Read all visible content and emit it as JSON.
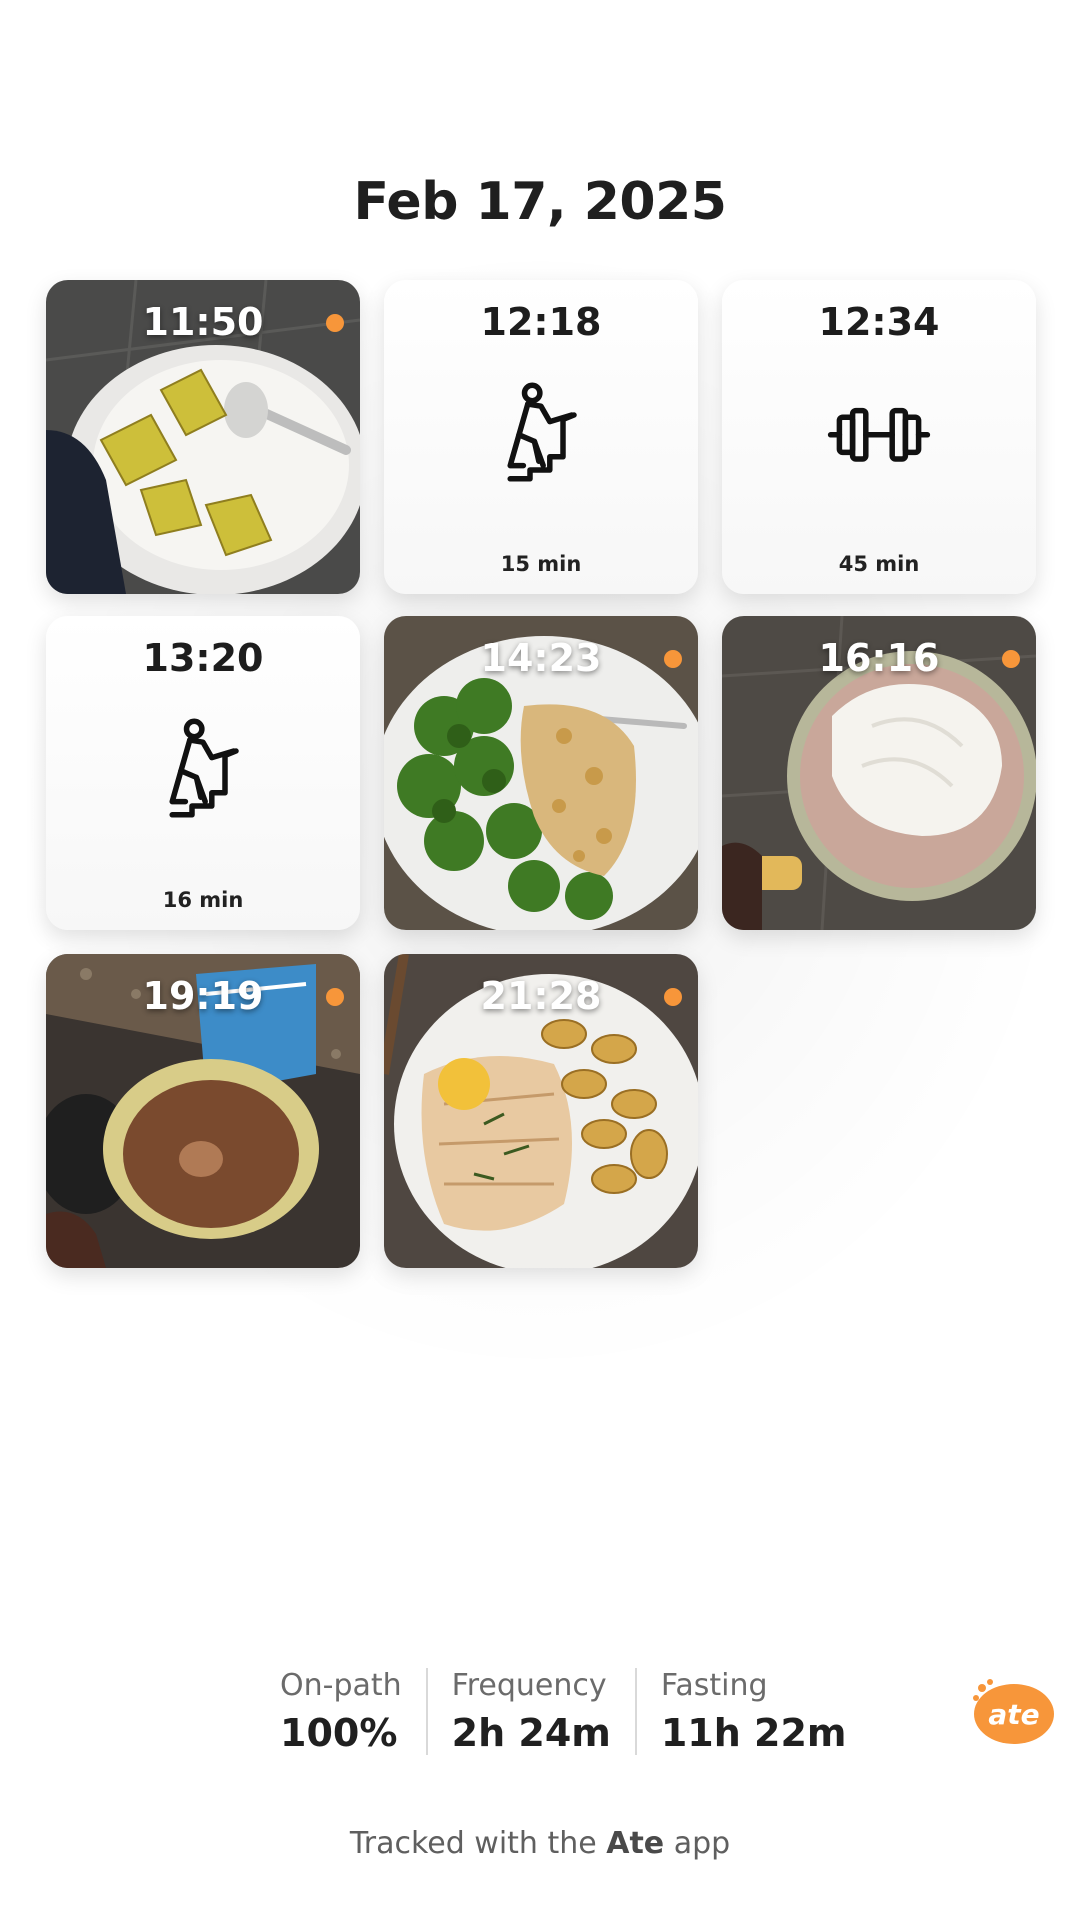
{
  "header": {
    "date": "Feb 17, 2025"
  },
  "accent_color": "#f7963a",
  "tiles": [
    {
      "kind": "photo",
      "time": "11:50",
      "subject": "kiwi-yogurt-bowl",
      "has_dot": true
    },
    {
      "kind": "activity",
      "time": "12:18",
      "icon": "stair-climber-icon",
      "duration": "15 min"
    },
    {
      "kind": "activity",
      "time": "12:34",
      "icon": "dumbbell-icon",
      "duration": "45 min"
    },
    {
      "kind": "activity",
      "time": "13:20",
      "icon": "stair-climber-icon",
      "duration": "16 min"
    },
    {
      "kind": "photo",
      "time": "14:23",
      "subject": "broccoli-salmon-plate",
      "has_dot": true
    },
    {
      "kind": "photo",
      "time": "16:16",
      "subject": "hot-chocolate-whipped-cream",
      "has_dot": true
    },
    {
      "kind": "photo",
      "time": "19:19",
      "subject": "hot-chocolate-mug",
      "has_dot": true
    },
    {
      "kind": "photo",
      "time": "21:28",
      "subject": "fish-potatoes-plate",
      "has_dot": true
    }
  ],
  "stats": [
    {
      "label": "On-path",
      "value": "100%"
    },
    {
      "label": "Frequency",
      "value": "2h 24m"
    },
    {
      "label": "Fasting",
      "value": "11h 22m"
    }
  ],
  "brand": {
    "logo_text": "ate"
  },
  "footer": {
    "prefix": "Tracked with the",
    "app_name": "Ate",
    "suffix": "app"
  }
}
